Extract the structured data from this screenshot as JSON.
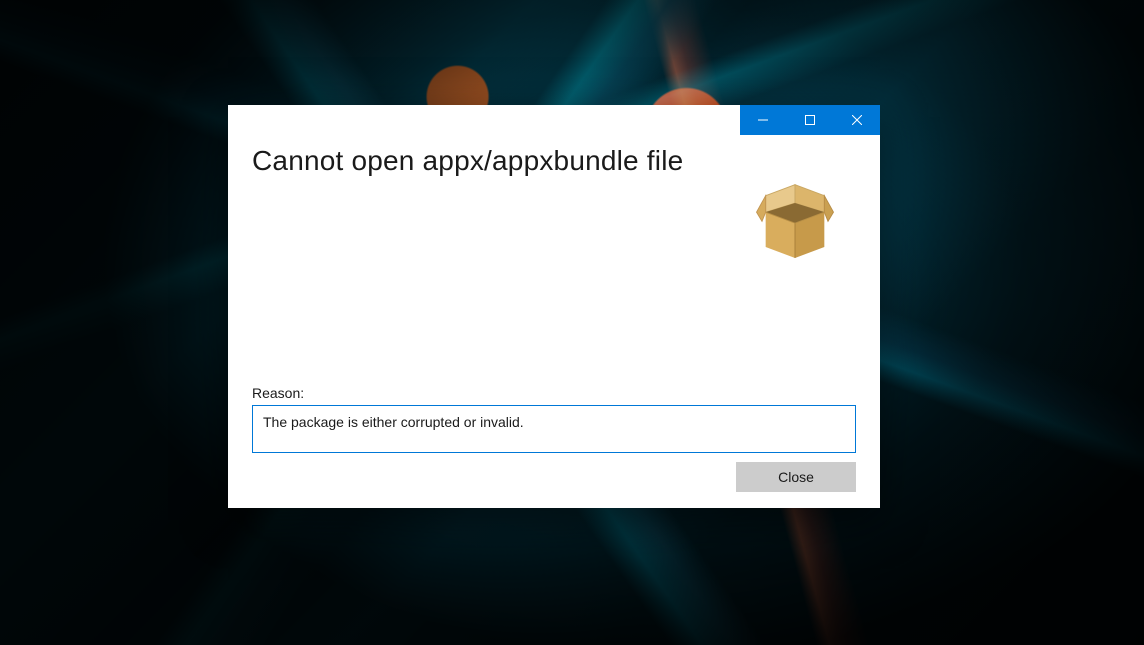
{
  "dialog": {
    "heading": "Cannot open appx/appxbundle file",
    "reason_label": "Reason:",
    "reason_text": "The package is either corrupted or invalid.",
    "close_label": "Close",
    "icon_name": "package-box-icon",
    "titlebar": {
      "minimize": "minimize",
      "maximize": "maximize",
      "close": "close",
      "color": "#0078d7"
    }
  }
}
